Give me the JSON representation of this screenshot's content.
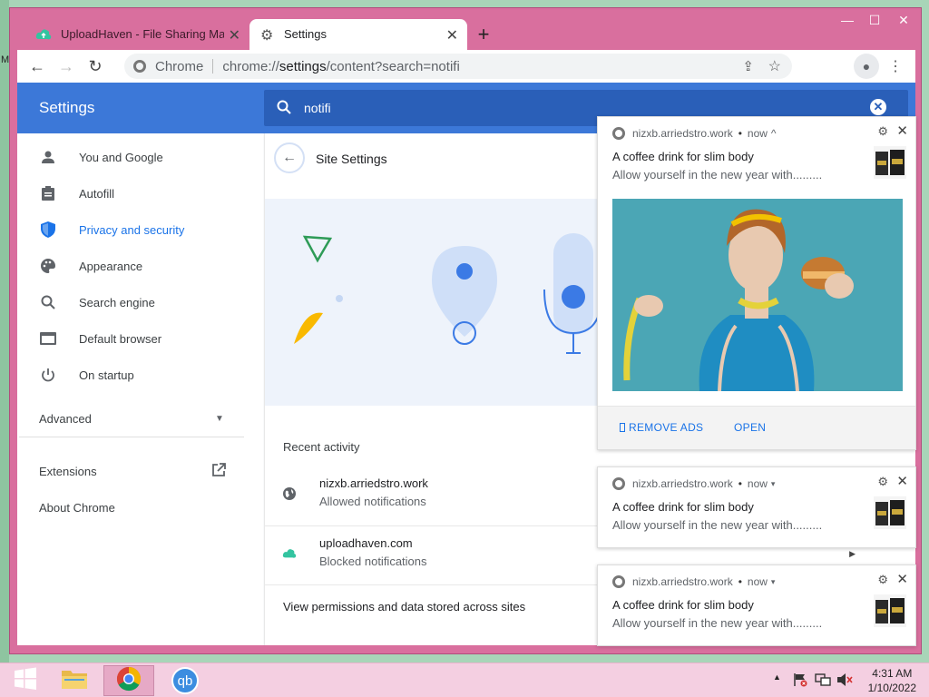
{
  "desktop": {
    "edge_letter": "M"
  },
  "window": {
    "tabs": [
      {
        "title": "UploadHaven - File Sharing Mad",
        "close": "✕"
      },
      {
        "title": "Settings",
        "close": "✕"
      }
    ],
    "new_tab": "+",
    "controls": {
      "minimize": "—",
      "maximize": "☐",
      "close": "✕"
    }
  },
  "toolbar": {
    "site_label": "Chrome",
    "url_prefix": "chrome://",
    "url_host": "settings",
    "url_rest": "/content?search=notifi"
  },
  "settings": {
    "title": "Settings",
    "search_value": "notifi",
    "sidebar": [
      {
        "label": "You and Google",
        "icon": "person-icon",
        "active": false
      },
      {
        "label": "Autofill",
        "icon": "clipboard-icon",
        "active": false
      },
      {
        "label": "Privacy and security",
        "icon": "shield-icon",
        "active": true
      },
      {
        "label": "Appearance",
        "icon": "palette-icon",
        "active": false
      },
      {
        "label": "Search engine",
        "icon": "search-icon",
        "active": false
      },
      {
        "label": "Default browser",
        "icon": "browser-icon",
        "active": false
      },
      {
        "label": "On startup",
        "icon": "power-icon",
        "active": false
      }
    ],
    "advanced": "Advanced",
    "extensions": "Extensions",
    "about": "About Chrome",
    "page_title": "Site Settings",
    "recent_activity": "Recent activity",
    "recent": [
      {
        "site": "nizxb.arriedstro.work",
        "status": "Allowed notifications"
      },
      {
        "site": "uploadhaven.com",
        "status": "Blocked notifications"
      }
    ],
    "view_permissions": "View permissions and data stored across sites"
  },
  "notifications": [
    {
      "origin": "nizxb.arriedstro.work",
      "time": "now",
      "chevron": "^",
      "title": "A coffee drink for slim body",
      "body": "Allow yourself in the new year with.........",
      "expanded": true,
      "actions": [
        "REMOVE ADS",
        "OPEN"
      ]
    },
    {
      "origin": "nizxb.arriedstro.work",
      "time": "now",
      "chevron": "v",
      "title": "A coffee drink for slim body",
      "body": "Allow yourself in the new year with.........",
      "expanded": false
    },
    {
      "origin": "nizxb.arriedstro.work",
      "time": "now",
      "chevron": "v",
      "title": "A coffee drink for slim body",
      "body": "Allow yourself in the new year with.........",
      "expanded": false
    }
  ],
  "taskbar": {
    "qb_label": "qb",
    "clock_time": "4:31 AM",
    "clock_date": "1/10/2022"
  },
  "colors": {
    "accent": "#3c78d8",
    "window_frame": "#d96f9e",
    "link": "#1a73e8"
  }
}
